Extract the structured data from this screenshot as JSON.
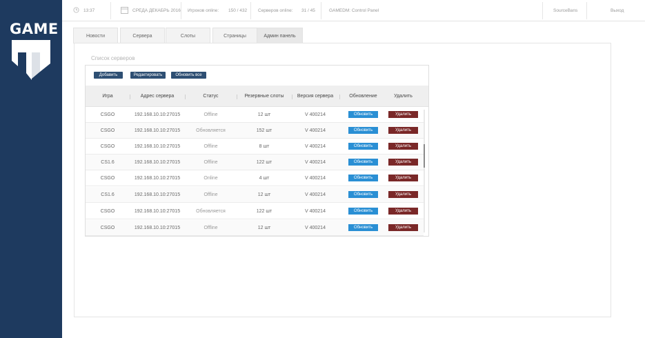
{
  "brand": {
    "logo_text": "GAME"
  },
  "topbar": {
    "time": "13:37",
    "date": "СРЕДА ДЕКАБРЬ 2016",
    "players_label": "Игроков online:",
    "players_value": "150 / 432",
    "servers_label": "Серверов online:",
    "servers_value": "31 / 45",
    "panel_name": "GAMEDM: Control Panel",
    "sourcebans": "SourceBans",
    "logout": "Выход"
  },
  "tabs": [
    {
      "label": "Новости"
    },
    {
      "label": "Сервера"
    },
    {
      "label": "Слоты"
    },
    {
      "label": "Страницы"
    },
    {
      "label": "Админ панель"
    }
  ],
  "panel": {
    "title": "Список серверов"
  },
  "actions": {
    "add": "Добавить",
    "edit": "Редактировать",
    "update_all": "Обновить все"
  },
  "columns": [
    "Игра",
    "Адрес сервера",
    "Статус",
    "Резервные слоты",
    "Версия сервера",
    "Обновление",
    "Удалить"
  ],
  "rows": [
    {
      "game": "CSGO",
      "address": "192.168.10.10:27015",
      "status": "Offline",
      "slots": "12 шт",
      "version": "V 400214",
      "update": "Обновить",
      "delete": "Удалить"
    },
    {
      "game": "CSGO",
      "address": "192.168.10.10:27015",
      "status": "Обновляется",
      "slots": "152 шт",
      "version": "V 400214",
      "update": "Обновить",
      "delete": "Удалить"
    },
    {
      "game": "CSGO",
      "address": "192.168.10.10:27015",
      "status": "Offline",
      "slots": "8 шт",
      "version": "V 400214",
      "update": "Обновить",
      "delete": "Удалить"
    },
    {
      "game": "CS1.6",
      "address": "192.168.10.10:27015",
      "status": "Offline",
      "slots": "122 шт",
      "version": "V 400214",
      "update": "Обновить",
      "delete": "Удалить"
    },
    {
      "game": "CSGO",
      "address": "192.168.10.10:27015",
      "status": "Online",
      "slots": "4 шт",
      "version": "V 400214",
      "update": "Обновить",
      "delete": "Удалить"
    },
    {
      "game": "CS1.6",
      "address": "192.168.10.10:27015",
      "status": "Offline",
      "slots": "12 шт",
      "version": "V 400214",
      "update": "Обновить",
      "delete": "Удалить"
    },
    {
      "game": "CSGO",
      "address": "192.168.10.10:27015",
      "status": "Обновляется",
      "slots": "122 шт",
      "version": "V 400214",
      "update": "Обновить",
      "delete": "Удалить"
    },
    {
      "game": "CSGO",
      "address": "192.168.10.10:27015",
      "status": "Offline",
      "slots": "12 шт",
      "version": "V 400214",
      "update": "Обновить",
      "delete": "Удалить"
    }
  ],
  "colors": {
    "sidebar": "#1e3a5f",
    "update_button": "#2a8fd4",
    "delete_button": "#7a2828",
    "action_button": "#2e4f73"
  },
  "icons": {
    "time": "clock-icon",
    "date": "calendar-icon"
  }
}
